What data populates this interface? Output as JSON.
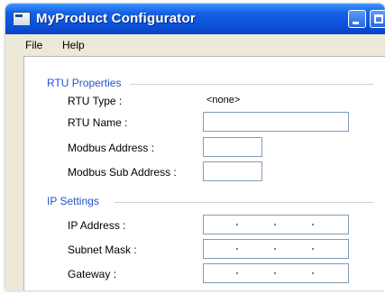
{
  "window": {
    "title": "MyProduct Configurator"
  },
  "menu": {
    "file": "File",
    "help": "Help"
  },
  "rtu": {
    "section_title": "RTU Properties",
    "type_label": "RTU Type :",
    "type_value": "<none>",
    "name_label": "RTU Name :",
    "name_value": "",
    "modbus_address_label": "Modbus Address :",
    "modbus_address_value": "",
    "modbus_sub_address_label": "Modbus Sub Address :",
    "modbus_sub_address_value": ""
  },
  "ip": {
    "section_title": "IP Settings",
    "ip_address_label": "IP Address :",
    "subnet_mask_label": "Subnet Mask :",
    "gateway_label": "Gateway :"
  },
  "colors": {
    "title_bar": "#0a4fd6",
    "section_title": "#2153c6",
    "window_background": "#ece9d8",
    "input_border": "#7f9db9"
  },
  "icons": {
    "app": "app-window-icon",
    "minimize": "minimize-icon",
    "maximize": "maximize-icon"
  }
}
